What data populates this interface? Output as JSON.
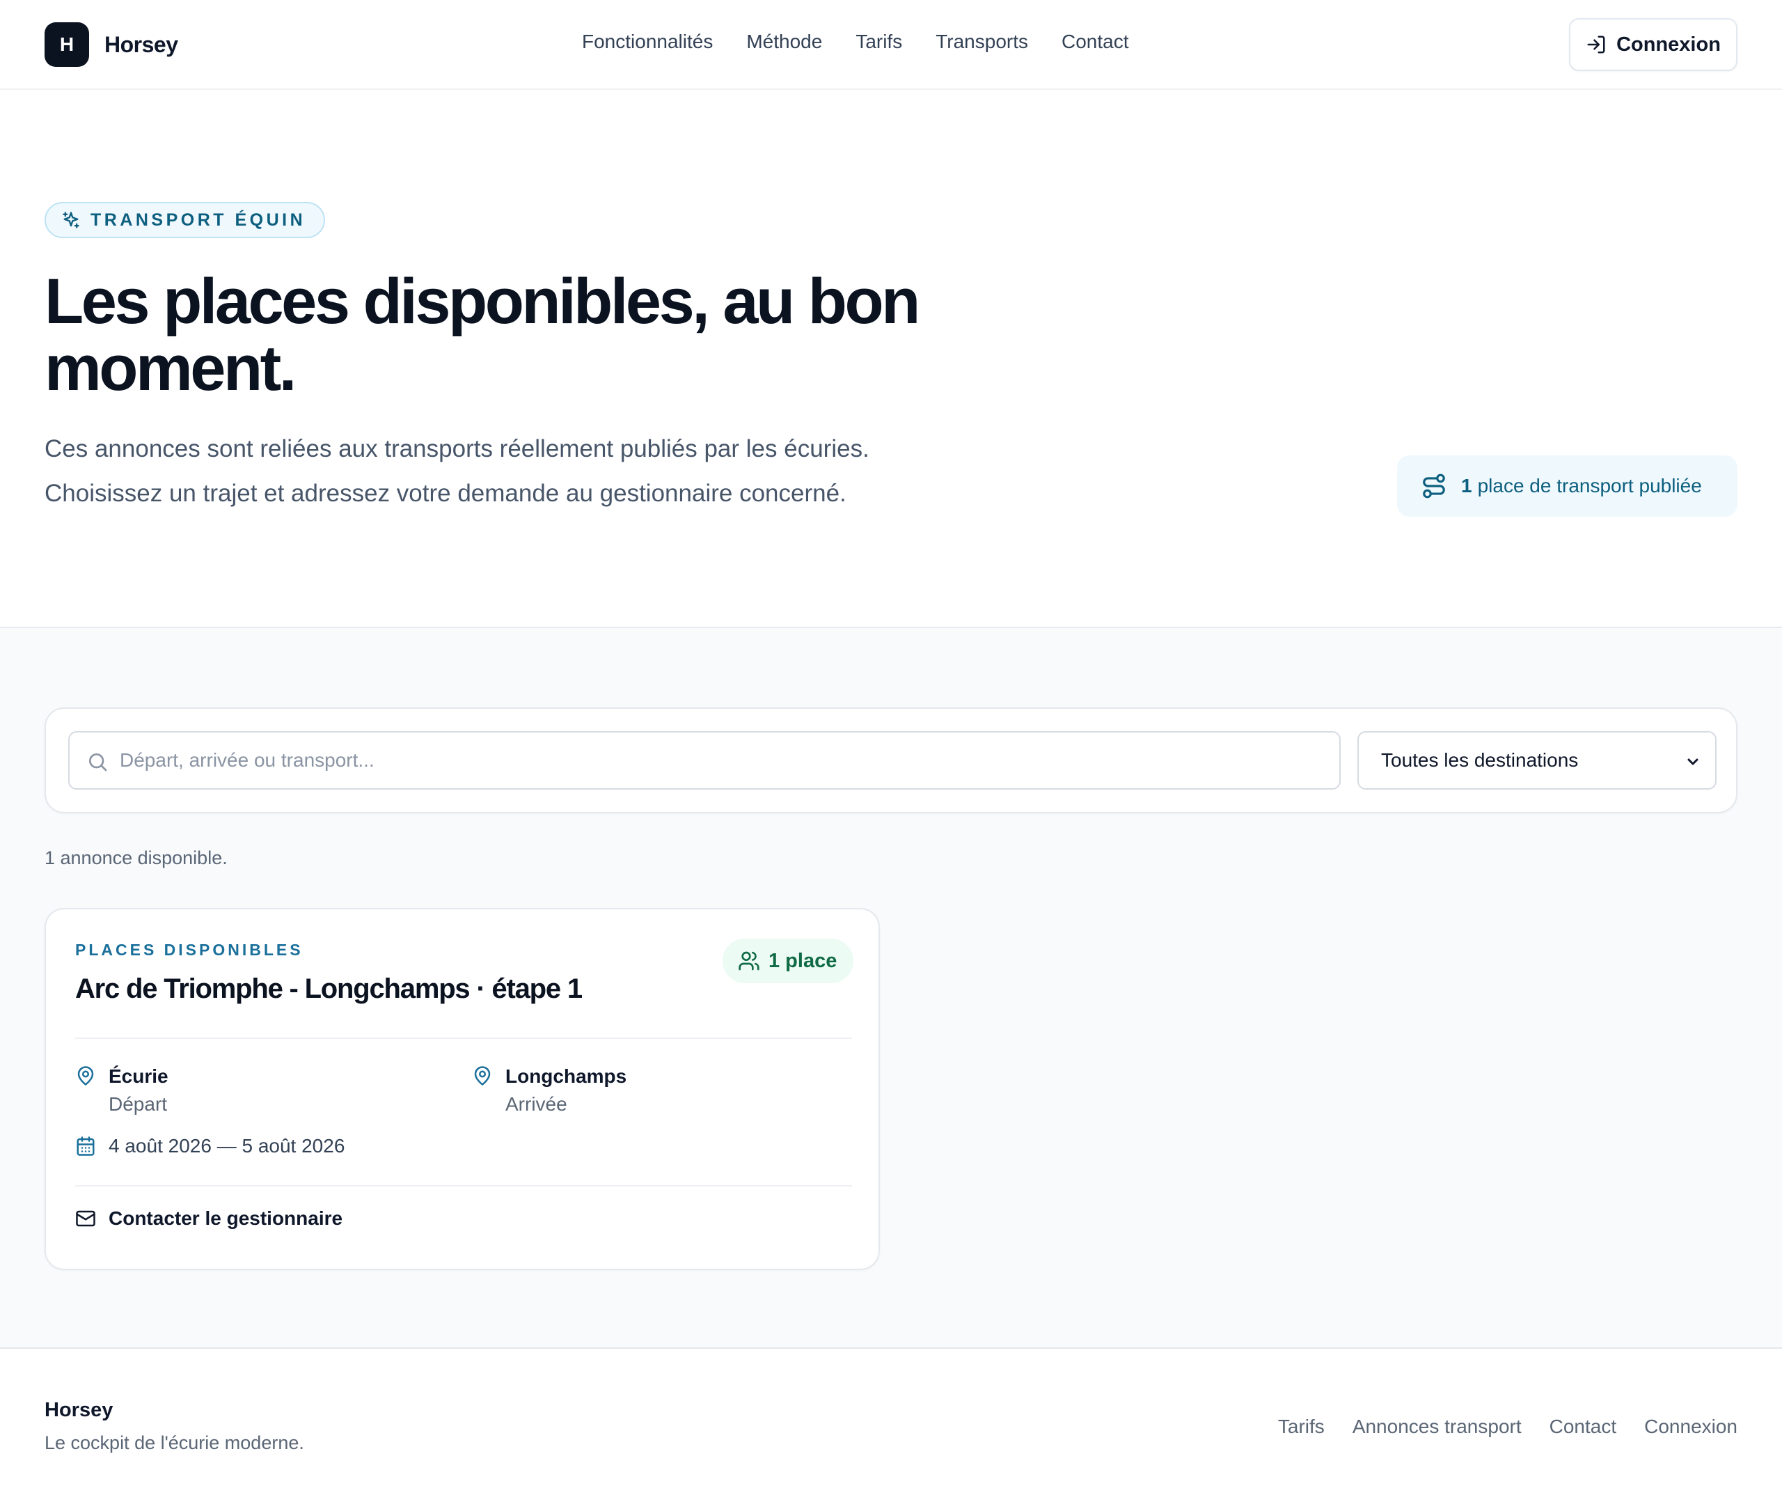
{
  "header": {
    "logo_letter": "H",
    "brand": "Horsey",
    "nav": [
      "Fonctionnalités",
      "Méthode",
      "Tarifs",
      "Transports",
      "Contact"
    ],
    "login_label": "Connexion"
  },
  "hero": {
    "badge": "TRANSPORT ÉQUIN",
    "title": "Les places disponibles, au bon moment.",
    "subtitle": "Ces annonces sont reliées aux transports réellement publiés par les écuries. Choisissez un trajet et adressez votre demande au gestionnaire concerné.",
    "count_number": "1",
    "count_label": "place de transport publiée"
  },
  "filters": {
    "search_placeholder": "Départ, arrivée ou transport...",
    "search_value": "",
    "destination_selected": "Toutes les destinations"
  },
  "results": {
    "count_text": "1 annonce disponible."
  },
  "listing": {
    "kicker": "PLACES DISPONIBLES",
    "title": "Arc de Triomphe - Longchamps · étape 1",
    "places": "1 place",
    "departure_name": "Écurie",
    "departure_role": "Départ",
    "arrival_name": "Longchamps",
    "arrival_role": "Arrivée",
    "dates": "4 août 2026 — 5 août 2026",
    "contact_label": "Contacter le gestionnaire"
  },
  "footer": {
    "brand": "Horsey",
    "tagline": "Le cockpit de l'écurie moderne.",
    "links": [
      "Tarifs",
      "Annonces transport",
      "Contact",
      "Connexion"
    ]
  },
  "colors": {
    "accent": "#0d5f7f",
    "success": "#0f6b45",
    "ink": "#0b1220"
  }
}
